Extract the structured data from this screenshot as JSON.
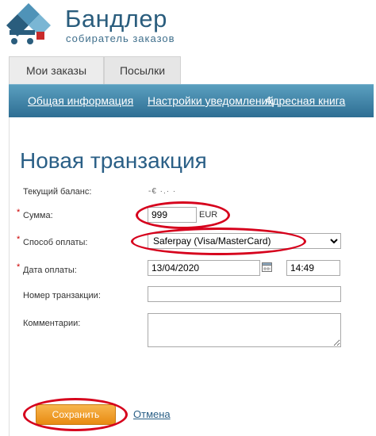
{
  "brand": {
    "name": "Бандлер",
    "tagline": "собиратель заказов"
  },
  "tabs": [
    {
      "label": "Мои заказы"
    },
    {
      "label": "Посылки"
    }
  ],
  "nav": [
    {
      "label": "Общая информация"
    },
    {
      "label": "Настройки уведомлений"
    },
    {
      "label": "Адресная книга"
    }
  ],
  "page": {
    "title": "Новая транзакция"
  },
  "form": {
    "balance_label": "Текущий баланс:",
    "balance_value": "-€ ·.· ·",
    "amount_label": "Сумма:",
    "amount_value": "999",
    "currency": "EUR",
    "payment_label": "Способ оплаты:",
    "payment_value": "Saferpay (Visa/MasterCard)",
    "date_label": "Дата оплаты:",
    "date_value": "13/04/2020",
    "time_value": "14:49",
    "txn_label": "Номер транзакции:",
    "txn_value": "",
    "comments_label": "Комментарии:",
    "comments_value": "",
    "required_mark": "*"
  },
  "actions": {
    "save_label": "Сохранить",
    "cancel_label": "Отмена"
  },
  "colors": {
    "brand_blue": "#2a5d7d",
    "nav_top": "#5a9fbf",
    "nav_bottom": "#2e6e93",
    "title_blue": "#2a5f86",
    "highlight_red": "#d6001c",
    "save_orange": "#e88a12"
  }
}
